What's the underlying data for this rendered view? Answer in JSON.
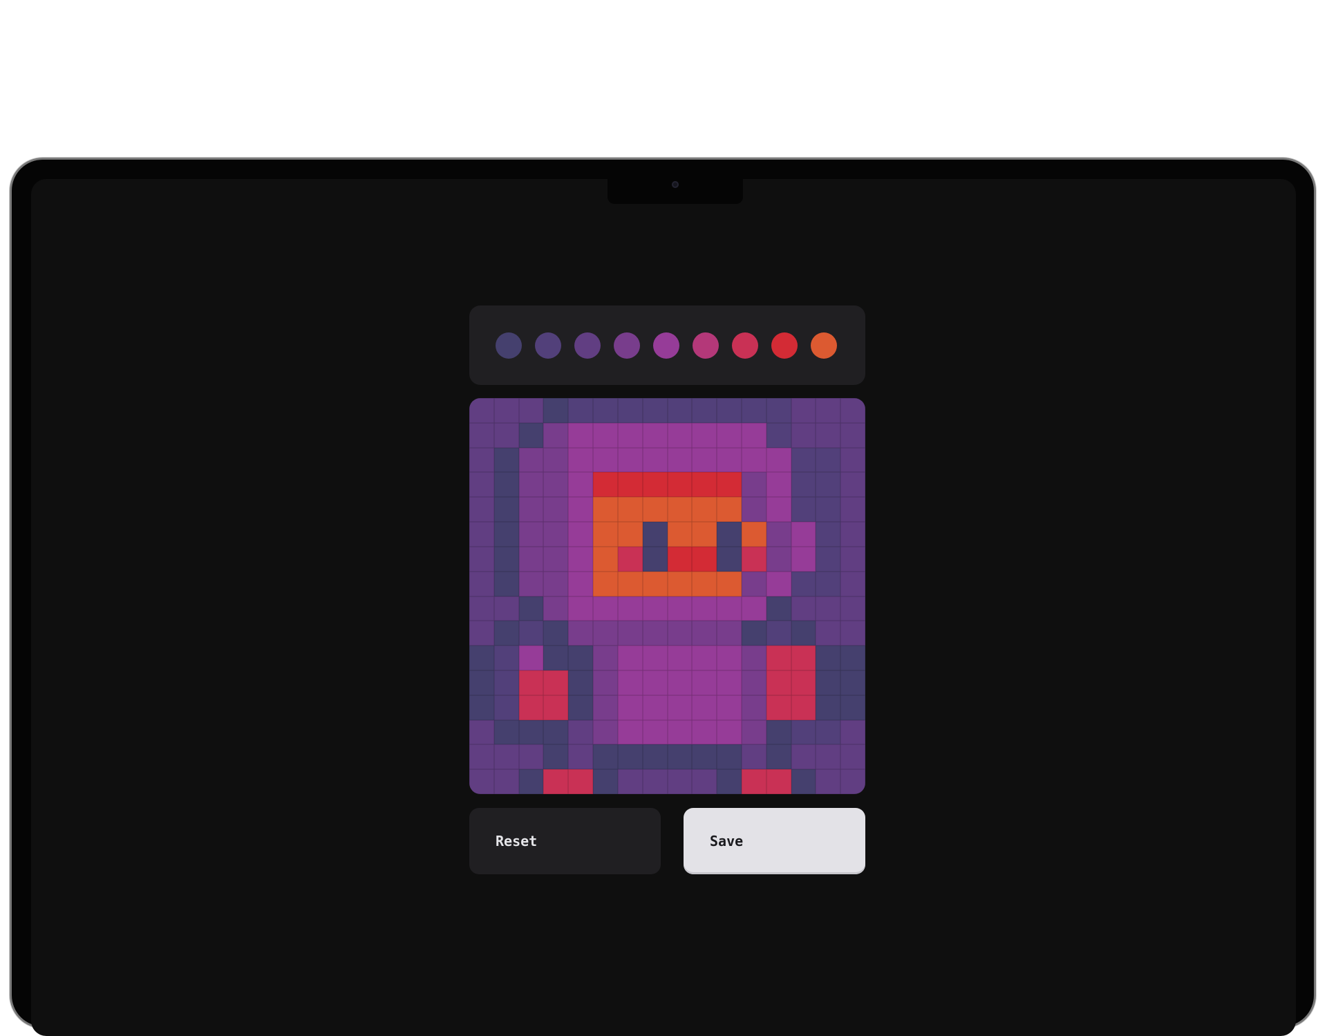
{
  "palette": {
    "colors": [
      "#45406e",
      "#52407a",
      "#613e82",
      "#783d8c",
      "#963c98",
      "#b43879",
      "#c93155",
      "#d32b35",
      "#dc5a31"
    ]
  },
  "canvas": {
    "size": 16,
    "pixels": [
      [
        2,
        2,
        2,
        0,
        1,
        1,
        1,
        1,
        1,
        1,
        1,
        1,
        1,
        2,
        2,
        2
      ],
      [
        2,
        2,
        0,
        3,
        4,
        4,
        4,
        4,
        4,
        4,
        4,
        4,
        1,
        2,
        2,
        2
      ],
      [
        2,
        0,
        3,
        3,
        4,
        4,
        4,
        4,
        4,
        4,
        4,
        4,
        4,
        1,
        1,
        2
      ],
      [
        2,
        0,
        3,
        3,
        4,
        7,
        7,
        7,
        7,
        7,
        7,
        3,
        4,
        1,
        1,
        2
      ],
      [
        2,
        0,
        3,
        3,
        4,
        8,
        8,
        8,
        8,
        8,
        8,
        3,
        4,
        1,
        1,
        2
      ],
      [
        2,
        0,
        3,
        3,
        4,
        8,
        8,
        0,
        8,
        8,
        0,
        8,
        3,
        4,
        1,
        2
      ],
      [
        2,
        0,
        3,
        3,
        4,
        8,
        6,
        0,
        7,
        7,
        0,
        6,
        3,
        4,
        1,
        2
      ],
      [
        2,
        0,
        3,
        3,
        4,
        8,
        8,
        8,
        8,
        8,
        8,
        3,
        4,
        1,
        1,
        2
      ],
      [
        2,
        2,
        0,
        3,
        4,
        4,
        4,
        4,
        4,
        4,
        4,
        4,
        0,
        2,
        2,
        2
      ],
      [
        2,
        0,
        1,
        0,
        3,
        3,
        3,
        3,
        3,
        3,
        3,
        0,
        1,
        0,
        2,
        2
      ],
      [
        0,
        1,
        4,
        0,
        0,
        3,
        4,
        4,
        4,
        4,
        4,
        3,
        6,
        6,
        0,
        0
      ],
      [
        0,
        1,
        6,
        6,
        0,
        3,
        4,
        4,
        4,
        4,
        4,
        3,
        6,
        6,
        0,
        0
      ],
      [
        0,
        1,
        6,
        6,
        0,
        3,
        4,
        4,
        4,
        4,
        4,
        3,
        6,
        6,
        0,
        0
      ],
      [
        2,
        0,
        0,
        0,
        2,
        3,
        4,
        4,
        4,
        4,
        4,
        3,
        0,
        1,
        1,
        2
      ],
      [
        2,
        2,
        2,
        0,
        2,
        0,
        0,
        0,
        0,
        0,
        0,
        2,
        0,
        2,
        2,
        2
      ],
      [
        2,
        2,
        0,
        6,
        6,
        0,
        2,
        2,
        2,
        2,
        0,
        6,
        6,
        0,
        2,
        2
      ]
    ]
  },
  "buttons": {
    "reset_label": "Reset",
    "save_label": "Save"
  }
}
